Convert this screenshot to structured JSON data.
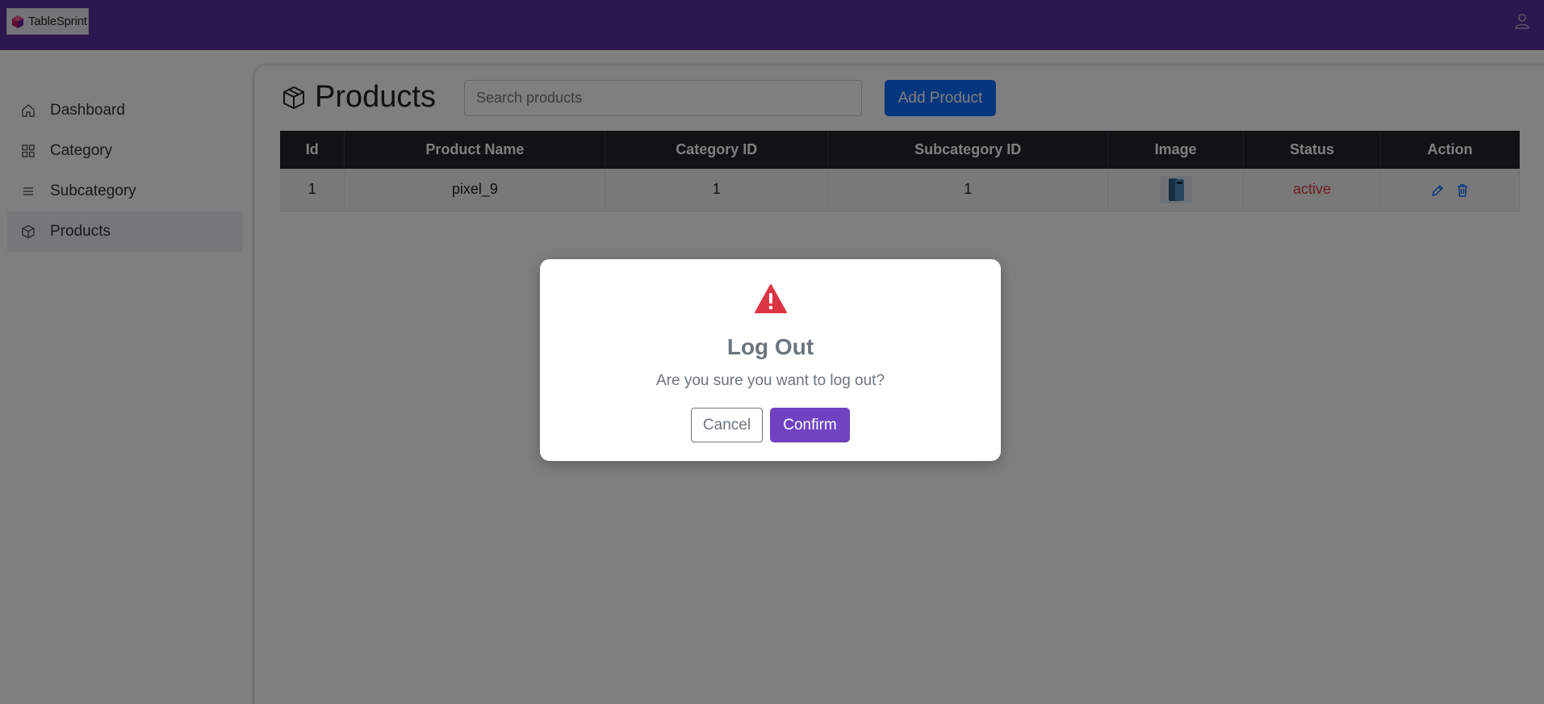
{
  "app": {
    "logo_text": "TableSprint"
  },
  "colors": {
    "topbar": "#5b2e9e",
    "primary": "#0d6efd",
    "confirm": "#6f42c1",
    "danger": "#dc3545",
    "table_header": "#212529"
  },
  "sidebar": {
    "items": [
      {
        "label": "Dashboard",
        "icon": "home-icon"
      },
      {
        "label": "Category",
        "icon": "grid-icon"
      },
      {
        "label": "Subcategory",
        "icon": "list-icon"
      },
      {
        "label": "Products",
        "icon": "box-icon",
        "active": true
      }
    ]
  },
  "main": {
    "title": "Products",
    "search": {
      "placeholder": "Search products",
      "value": ""
    },
    "add_label": "Add Product",
    "table": {
      "headers": [
        "Id",
        "Product Name",
        "Category ID",
        "Subcategory ID",
        "Image",
        "Status",
        "Action"
      ],
      "rows": [
        {
          "id": "1",
          "name": "pixel_9",
          "category_id": "1",
          "subcategory_id": "1",
          "image": "phone-thumbnail",
          "status": "active"
        }
      ]
    }
  },
  "modal": {
    "title": "Log Out",
    "message": "Are you sure you want to log out?",
    "cancel_label": "Cancel",
    "confirm_label": "Confirm"
  }
}
